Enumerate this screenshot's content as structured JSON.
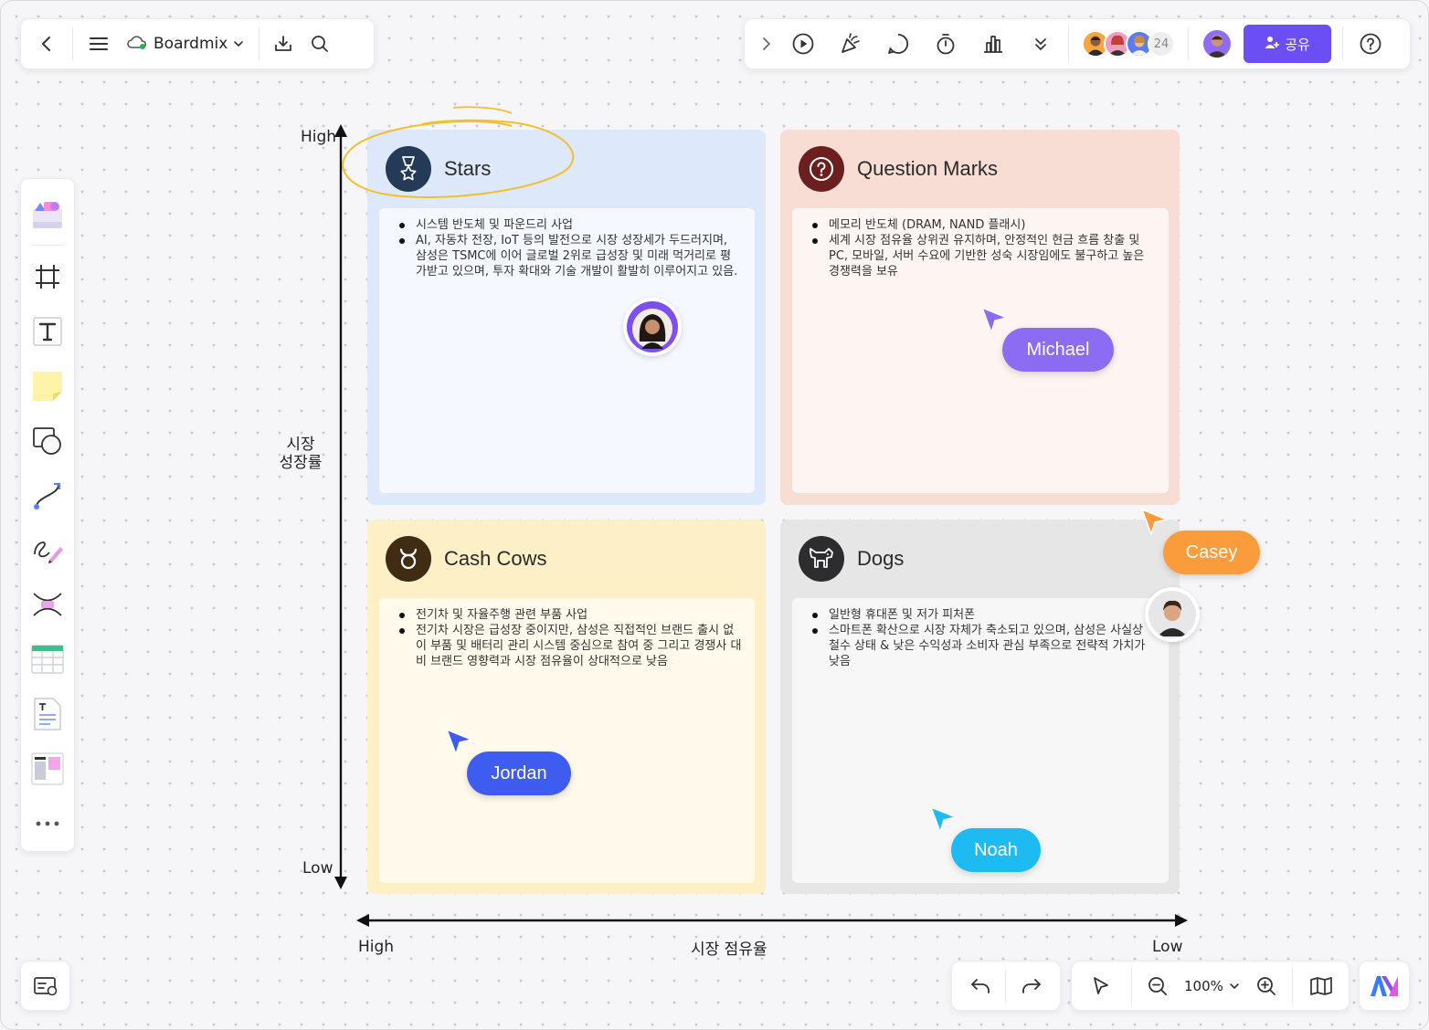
{
  "toolbar_left": {
    "brand": "Boardmix"
  },
  "toolbar_right": {
    "online_count": "24",
    "share_label": "공유"
  },
  "zoom": {
    "level": "100%"
  },
  "axes": {
    "y_high": "High",
    "y_low": "Low",
    "y_title_line1": "시장",
    "y_title_line2": "성장률",
    "x_high": "High",
    "x_low": "Low",
    "x_title": "시장 점유율"
  },
  "quadrants": {
    "stars": {
      "title": "Stars",
      "items": [
        "시스템 반도체 및 파운드리 사업",
        "AI, 자동차 전장, IoT 등의 발전으로 시장 성장세가 두드러지며, 삼성은 TSMC에 이어 글로벌 2위로 급성장 및 미래 먹거리로 평가받고 있으며, 투자 확대와 기술 개발이 활발히 이루어지고 있음."
      ]
    },
    "question_marks": {
      "title": "Question Marks",
      "items": [
        "메모리 반도체 (DRAM, NAND 플래시)",
        "세계 시장 점유율 상위권 유지하며, 안정적인 현금 흐름 창출 및 PC, 모바일, 서버 수요에 기반한 성숙 시장임에도 불구하고 높은 경쟁력을 보유"
      ]
    },
    "cash_cows": {
      "title": "Cash Cows",
      "items": [
        "전기차 및 자율주행 관련 부품 사업",
        "전기차 시장은 급성장 중이지만, 삼성은 직접적인 브랜드 출시 없이 부품 및 배터리 관리 시스템 중심으로 참여 중 그리고 경쟁사 대비 브랜드 영향력과 시장 점유율이 상대적으로 낮음"
      ]
    },
    "dogs": {
      "title": "Dogs",
      "items": [
        "일반형 휴대폰 및 저가 피처폰",
        "스마트폰 확산으로 시장 자체가 축소되고 있으며, 삼성은 사실상 철수 상태 & 낮은 수익성과 소비자 관심 부족으로 전략적 가치가 낮음"
      ]
    }
  },
  "collaborators": [
    {
      "name": "Michael",
      "color": "#8b6cf3"
    },
    {
      "name": "Casey",
      "color": "#fb9c3c"
    },
    {
      "name": "Jordan",
      "color": "#3f5cf0"
    },
    {
      "name": "Noah",
      "color": "#1ebbf2"
    }
  ]
}
